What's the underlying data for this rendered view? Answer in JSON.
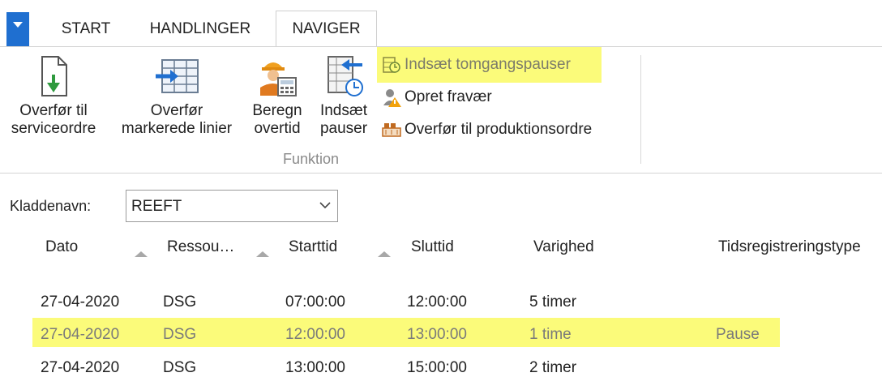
{
  "tabs": [
    {
      "label": "START",
      "active": false
    },
    {
      "label": "HANDLINGER",
      "active": false
    },
    {
      "label": "NAVIGER",
      "active": true
    }
  ],
  "ribbon": {
    "buttons": [
      {
        "line1": "Overfør til",
        "line2": "serviceordre",
        "icon": "document-transfer-icon"
      },
      {
        "line1": "Overfør",
        "line2": "markerede linier",
        "icon": "grid-transfer-icon"
      },
      {
        "line1": "Beregn",
        "line2": "overtid",
        "icon": "worker-calculator-icon"
      },
      {
        "line1": "Indsæt",
        "line2": "pauser",
        "icon": "table-clock-icon"
      }
    ],
    "small_actions": [
      {
        "label": "Indsæt tomgangspauser",
        "icon": "insert-idle-pause-icon",
        "highlighted": true
      },
      {
        "label": "Opret fravær",
        "icon": "absence-person-icon",
        "highlighted": false
      },
      {
        "label": "Overfør til produktionsordre",
        "icon": "production-order-icon",
        "highlighted": false
      }
    ],
    "group_label": "Funktion"
  },
  "batch": {
    "label": "Kladdenavn:",
    "value": "REEFT"
  },
  "grid": {
    "columns": [
      "Dato",
      "Ressou…",
      "Starttid",
      "Sluttid",
      "Varighed",
      "Tidsregistreringstype"
    ],
    "rows": [
      {
        "dato": "27-04-2020",
        "ressource": "DSG",
        "start": "07:00:00",
        "slut": "12:00:00",
        "varighed": "5 timer",
        "type": "",
        "highlighted": false
      },
      {
        "dato": "27-04-2020",
        "ressource": "DSG",
        "start": "12:00:00",
        "slut": "13:00:00",
        "varighed": "1 time",
        "type": "Pause",
        "highlighted": true
      },
      {
        "dato": "27-04-2020",
        "ressource": "DSG",
        "start": "13:00:00",
        "slut": "15:00:00",
        "varighed": "2 timer",
        "type": "",
        "highlighted": false
      }
    ]
  },
  "colors": {
    "accent": "#1f6fd0",
    "highlight": "#fbfb7a"
  }
}
